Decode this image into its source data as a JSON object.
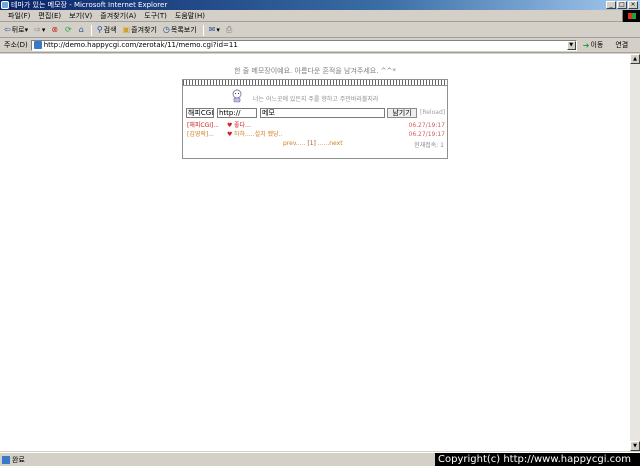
{
  "window": {
    "title": "테마가 있는 메모장 - Microsoft Internet Explorer"
  },
  "menu": [
    "파일(F)",
    "편집(E)",
    "보기(V)",
    "즐겨찾기(A)",
    "도구(T)",
    "도움말(H)"
  ],
  "toolbar": {
    "back": "뒤로",
    "search": "검색",
    "favorites": "즐겨찾기",
    "history": "목록보기"
  },
  "address": {
    "label": "주소(D)",
    "url": "http://demo.happycgi.com/zerotak/11/memo.cgi?id=11",
    "go": "이동",
    "links": "연결"
  },
  "page": {
    "headline": "한 줄 메모장이예요. 아름다운 흔적을 남겨주세요. ^^*",
    "slogan": "너는 어느곳에 있든지 주를 향하고 주만바라볼지라",
    "form": {
      "name_value": "해피CGI",
      "url_value": "http://",
      "memo_value": "메모",
      "submit_label": "남기기",
      "reload_label": "[Reload]"
    },
    "entries": [
      {
        "name": "[해피CGI]...",
        "message": "좋다...",
        "date": "06.27/19:17",
        "color": "#d02020"
      },
      {
        "name": "[김영락]...",
        "message": "하하.....설치 했당..",
        "date": "06.27/19:17",
        "color": "#d08020"
      }
    ],
    "pager": {
      "prev": "prev.....",
      "current": "[1]",
      "next": "......next"
    },
    "online": "현재접속: 1"
  },
  "status": {
    "text": "완료",
    "copyright": "Copyright(c) http://www.happycgi.com"
  }
}
